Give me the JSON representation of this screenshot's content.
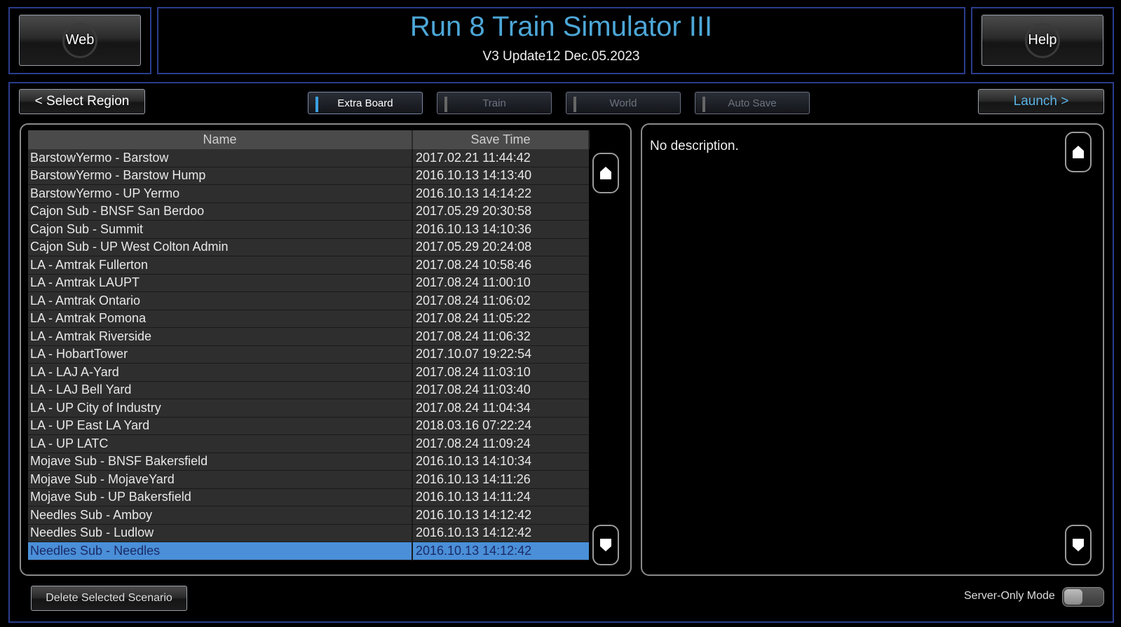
{
  "header": {
    "title": "Run 8 Train Simulator III",
    "version": "V3 Update12 Dec.05.2023",
    "web_label": "Web",
    "help_label": "Help"
  },
  "toolbar": {
    "select_region_label": "< Select Region",
    "launch_label": "Launch >",
    "tabs": [
      {
        "label": "Extra Board",
        "active": true
      },
      {
        "label": "Train",
        "active": false
      },
      {
        "label": "World",
        "active": false
      },
      {
        "label": "Auto Save",
        "active": false
      }
    ]
  },
  "table": {
    "columns": [
      "Name",
      "Save Time"
    ],
    "rows": [
      {
        "name": "BarstowYermo - Barstow",
        "time": "2017.02.21 11:44:42"
      },
      {
        "name": "BarstowYermo - Barstow Hump",
        "time": "2016.10.13 14:13:40"
      },
      {
        "name": "BarstowYermo - UP Yermo",
        "time": "2016.10.13 14:14:22"
      },
      {
        "name": "Cajon Sub - BNSF San Berdoo",
        "time": "2017.05.29 20:30:58"
      },
      {
        "name": "Cajon Sub - Summit",
        "time": "2016.10.13 14:10:36"
      },
      {
        "name": "Cajon Sub - UP West Colton Admin",
        "time": "2017.05.29 20:24:08"
      },
      {
        "name": "LA - Amtrak Fullerton",
        "time": "2017.08.24 10:58:46"
      },
      {
        "name": "LA - Amtrak LAUPT",
        "time": "2017.08.24 11:00:10"
      },
      {
        "name": "LA - Amtrak Ontario",
        "time": "2017.08.24 11:06:02"
      },
      {
        "name": "LA - Amtrak Pomona",
        "time": "2017.08.24 11:05:22"
      },
      {
        "name": "LA - Amtrak Riverside",
        "time": "2017.08.24 11:06:32"
      },
      {
        "name": "LA - HobartTower",
        "time": "2017.10.07 19:22:54"
      },
      {
        "name": "LA - LAJ A-Yard",
        "time": "2017.08.24 11:03:10"
      },
      {
        "name": "LA - LAJ Bell Yard",
        "time": "2017.08.24 11:03:40"
      },
      {
        "name": "LA - UP City of Industry",
        "time": "2017.08.24 11:04:34"
      },
      {
        "name": "LA - UP East LA Yard",
        "time": "2018.03.16 07:22:24"
      },
      {
        "name": "LA - UP LATC",
        "time": "2017.08.24 11:09:24"
      },
      {
        "name": "Mojave Sub - BNSF Bakersfield",
        "time": "2016.10.13 14:10:34"
      },
      {
        "name": "Mojave Sub - MojaveYard",
        "time": "2016.10.13 14:11:26"
      },
      {
        "name": "Mojave Sub - UP Bakersfield",
        "time": "2016.10.13 14:11:24"
      },
      {
        "name": "Needles Sub - Amboy",
        "time": "2016.10.13 14:12:42"
      },
      {
        "name": "Needles Sub - Ludlow",
        "time": "2016.10.13 14:12:42"
      },
      {
        "name": "Needles Sub - Needles",
        "time": "2016.10.13 14:12:42",
        "selected": true
      }
    ]
  },
  "description": {
    "text": "No description."
  },
  "footer": {
    "delete_label": "Delete Selected Scenario",
    "server_only_label": "Server-Only Mode",
    "server_only_on": false
  },
  "icons": {
    "scroll_up": "arrow-up-icon",
    "scroll_down": "arrow-down-icon"
  }
}
